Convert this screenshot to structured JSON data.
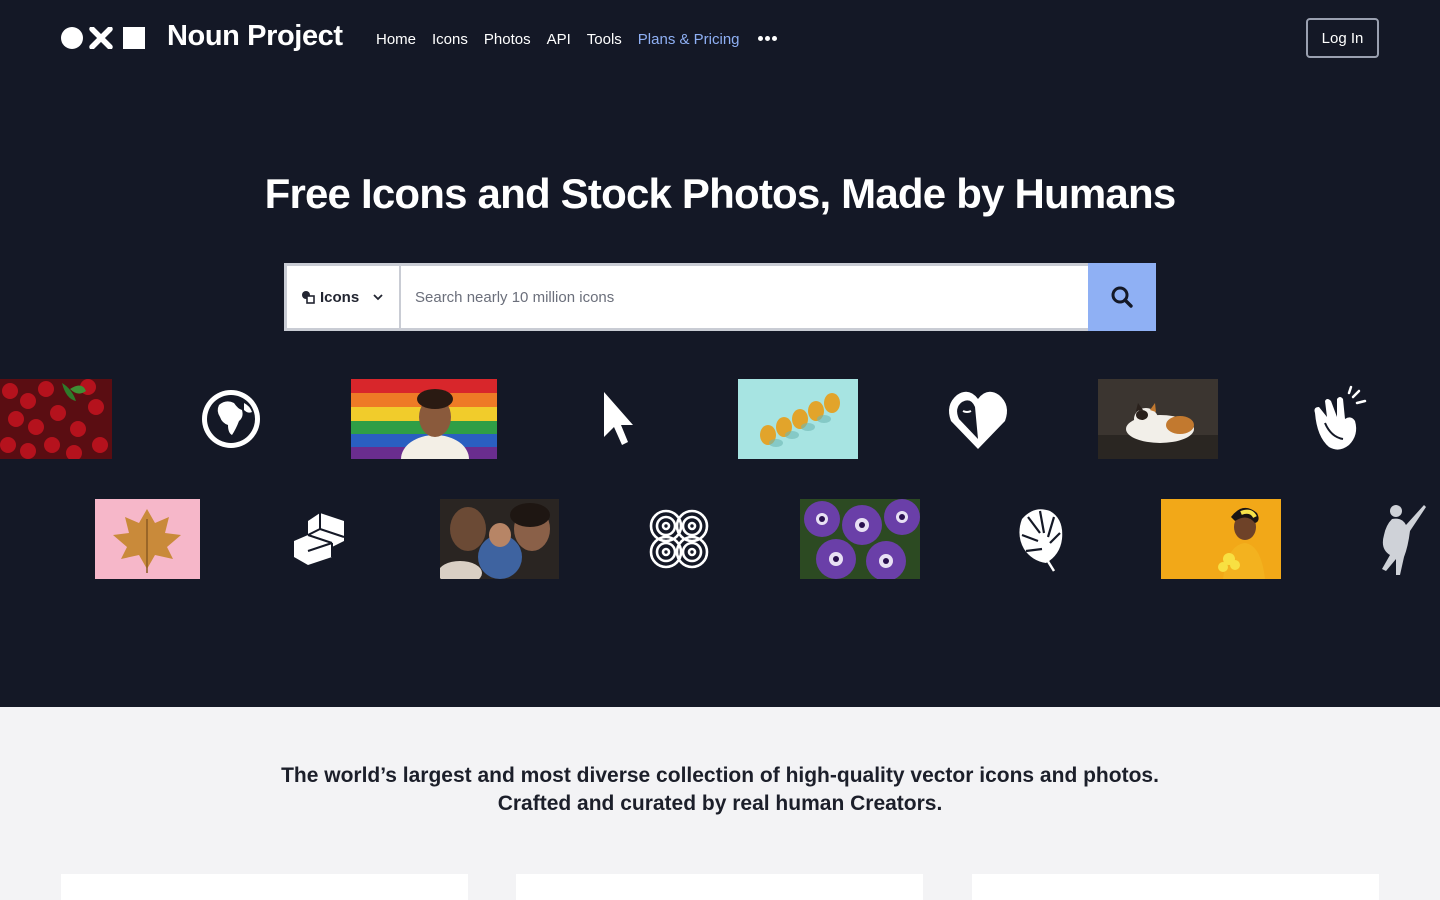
{
  "nav": {
    "brand": "Noun Project",
    "links": [
      {
        "label": "Home"
      },
      {
        "label": "Icons"
      },
      {
        "label": "Photos"
      },
      {
        "label": "API"
      },
      {
        "label": "Tools"
      },
      {
        "label": "Plans & Pricing",
        "accent": true
      }
    ],
    "login_label": "Log In"
  },
  "hero": {
    "headline": "Free Icons and Stock Photos, Made by Humans"
  },
  "search": {
    "type_label": "Icons",
    "placeholder": "Search nearly 10 million icons"
  },
  "carousel": {
    "row1": [
      "cherries-photo",
      "globe-icon",
      "pride-flag-portrait-photo",
      "cursor-arrow-icon",
      "pears-photo",
      "heart-face-icon",
      "calico-cat-photo",
      "clapping-hands-icon"
    ],
    "row2": [
      "golden-leaf-photo",
      "isometric-blocks-icon",
      "family-with-baby-photo",
      "knot-pattern-icon",
      "petunia-flowers-photo",
      "monstera-leaf-icon",
      "woman-yellow-background-photo",
      "dancer-icon"
    ]
  },
  "tagline": {
    "line1": "The world’s largest and most diverse collection of high-quality vector icons and photos.",
    "line2": "Crafted and curated by real human Creators."
  },
  "colors": {
    "hero_bg": "#141826",
    "accent": "#8fb0f4",
    "page_bg": "#f3f3f5"
  }
}
